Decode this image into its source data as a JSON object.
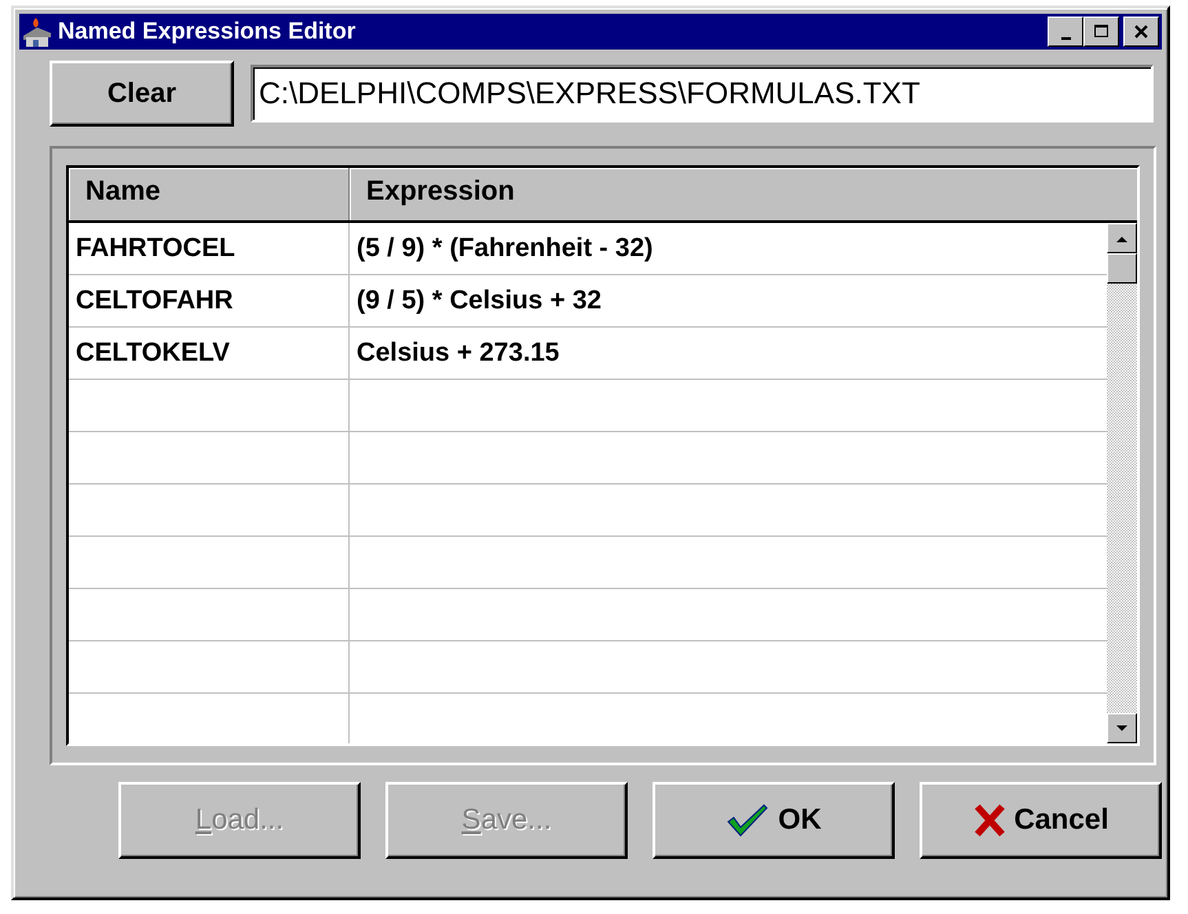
{
  "window": {
    "title": "Named Expressions Editor"
  },
  "clear_button": {
    "label": "Clear"
  },
  "file_path": {
    "value": "C:\\DELPHI\\COMPS\\EXPRESS\\FORMULAS.TXT"
  },
  "table": {
    "columns": [
      "Name",
      "Expression"
    ],
    "rows": [
      {
        "name": "FAHRTOCEL",
        "expression": "(5 / 9) * (Fahrenheit - 32)"
      },
      {
        "name": "CELTOFAHR",
        "expression": "(9 / 5) * Celsius + 32"
      },
      {
        "name": "CELTOKELV",
        "expression": "Celsius + 273.15"
      }
    ]
  },
  "buttons": [
    {
      "kind": "plain",
      "accelerator": "L",
      "rest": "oad...",
      "disabled": true
    },
    {
      "kind": "plain",
      "accelerator": "S",
      "rest": "ave...",
      "disabled": true
    },
    {
      "kind": "ok",
      "label": "OK",
      "disabled": false
    },
    {
      "kind": "cancel",
      "label": "Cancel",
      "disabled": false
    }
  ]
}
